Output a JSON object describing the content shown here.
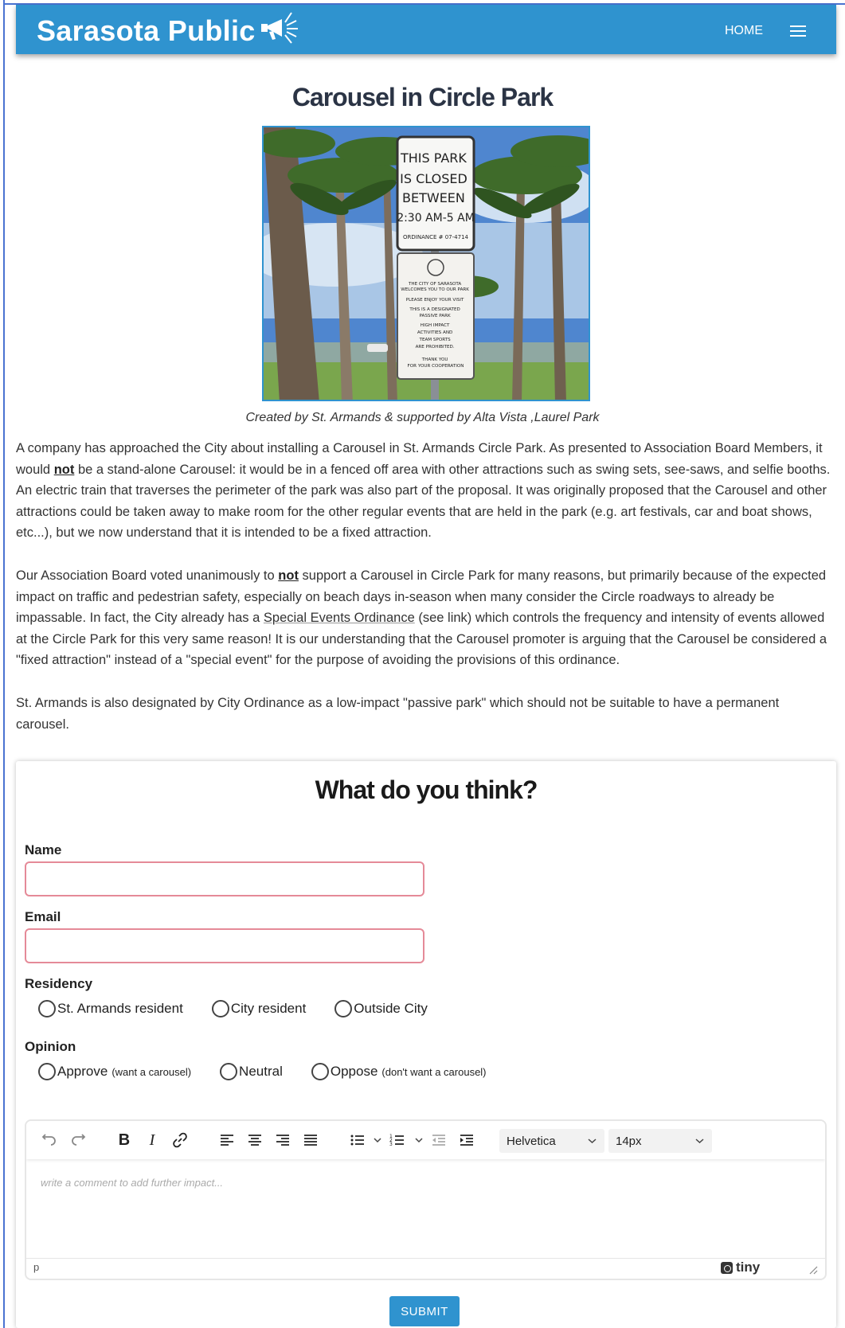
{
  "header": {
    "brand": "Sarasota Public",
    "brand_icon": "megaphone-icon",
    "nav_home": "HOME",
    "menu_icon": "hamburger-menu-icon",
    "color": "#2f93cf"
  },
  "article": {
    "title": "Carousel in Circle Park",
    "photo": {
      "sign_top": [
        "THIS PARK",
        "IS CLOSED",
        "BETWEEN",
        "2:30 AM-5 AM",
        "ORDINANCE # 07-4714"
      ],
      "sign_bottom": [
        "THE CITY OF SARASOTA",
        "WELCOMES YOU TO OUR PARK",
        "PLEASE ENJOY YOUR VISIT",
        "THIS IS A DESIGNATED",
        "PASSIVE PARK",
        "HIGH IMPACT",
        "ACTIVITIES AND",
        "TEAM SPORTS",
        "ARE PROHIBITED.",
        "THANK YOU",
        "FOR YOUR COOPERATION"
      ]
    },
    "caption": "Created by St. Armands & supported by Alta Vista ,Laurel Park",
    "p1": {
      "a": "A company has approached the City about installing a Carousel in St. Armands Circle Park.  As presented to Association Board Members, it would ",
      "b": "not",
      "c": " be a stand-alone Carousel:  it would be in a fenced off area with other attractions such as swing sets, see-saws, and selfie booths.  An electric train that traverses the perimeter of the park was also part of the proposal.  It was originally proposed that the Carousel and other attractions could be taken away to make room for the other regular events that are held in the park (e.g. art festivals, car and boat shows, etc...), but we now understand that it is intended to be a fixed attraction."
    },
    "p2": {
      "a": "Our Association Board voted unanimously to ",
      "b": "not",
      "c": " support a Carousel in Circle Park for many reasons, but primarily because of the expected impact on traffic and pedestrian safety, especially on beach days in-season when many consider the Circle roadways to already be impassable.  In fact, the City already has a ",
      "link": "Special Events Ordinance",
      "d": " (see link) which controls the frequency and intensity of events allowed at the Circle Park for this very same reason!  It is our understanding that the Carousel promoter is arguing that the Carousel be considered a \"fixed attraction\" instead of a \"special event\" for the purpose of avoiding the provisions of this ordinance."
    },
    "p3": "St. Armands is also designated by City Ordinance as a low-impact \"passive park\" which should not be suitable to have a permanent carousel."
  },
  "form": {
    "title": "What do you think?",
    "name_label": "Name",
    "name_value": "",
    "email_label": "Email",
    "email_value": "",
    "residency_label": "Residency",
    "residency_options": [
      "St. Armands resident",
      "City resident",
      "Outside City"
    ],
    "opinion_label": "Opinion",
    "opinion_options": [
      {
        "label": "Approve",
        "note": "(want a carousel)"
      },
      {
        "label": "Neutral",
        "note": ""
      },
      {
        "label": "Oppose",
        "note": "(don't want a carousel)"
      }
    ],
    "editor": {
      "font": "Helvetica",
      "size": "14px",
      "placeholder": "write a comment to add further impact...",
      "status_path": "p",
      "brand": "tiny"
    },
    "submit_label": "SUBMIT"
  }
}
